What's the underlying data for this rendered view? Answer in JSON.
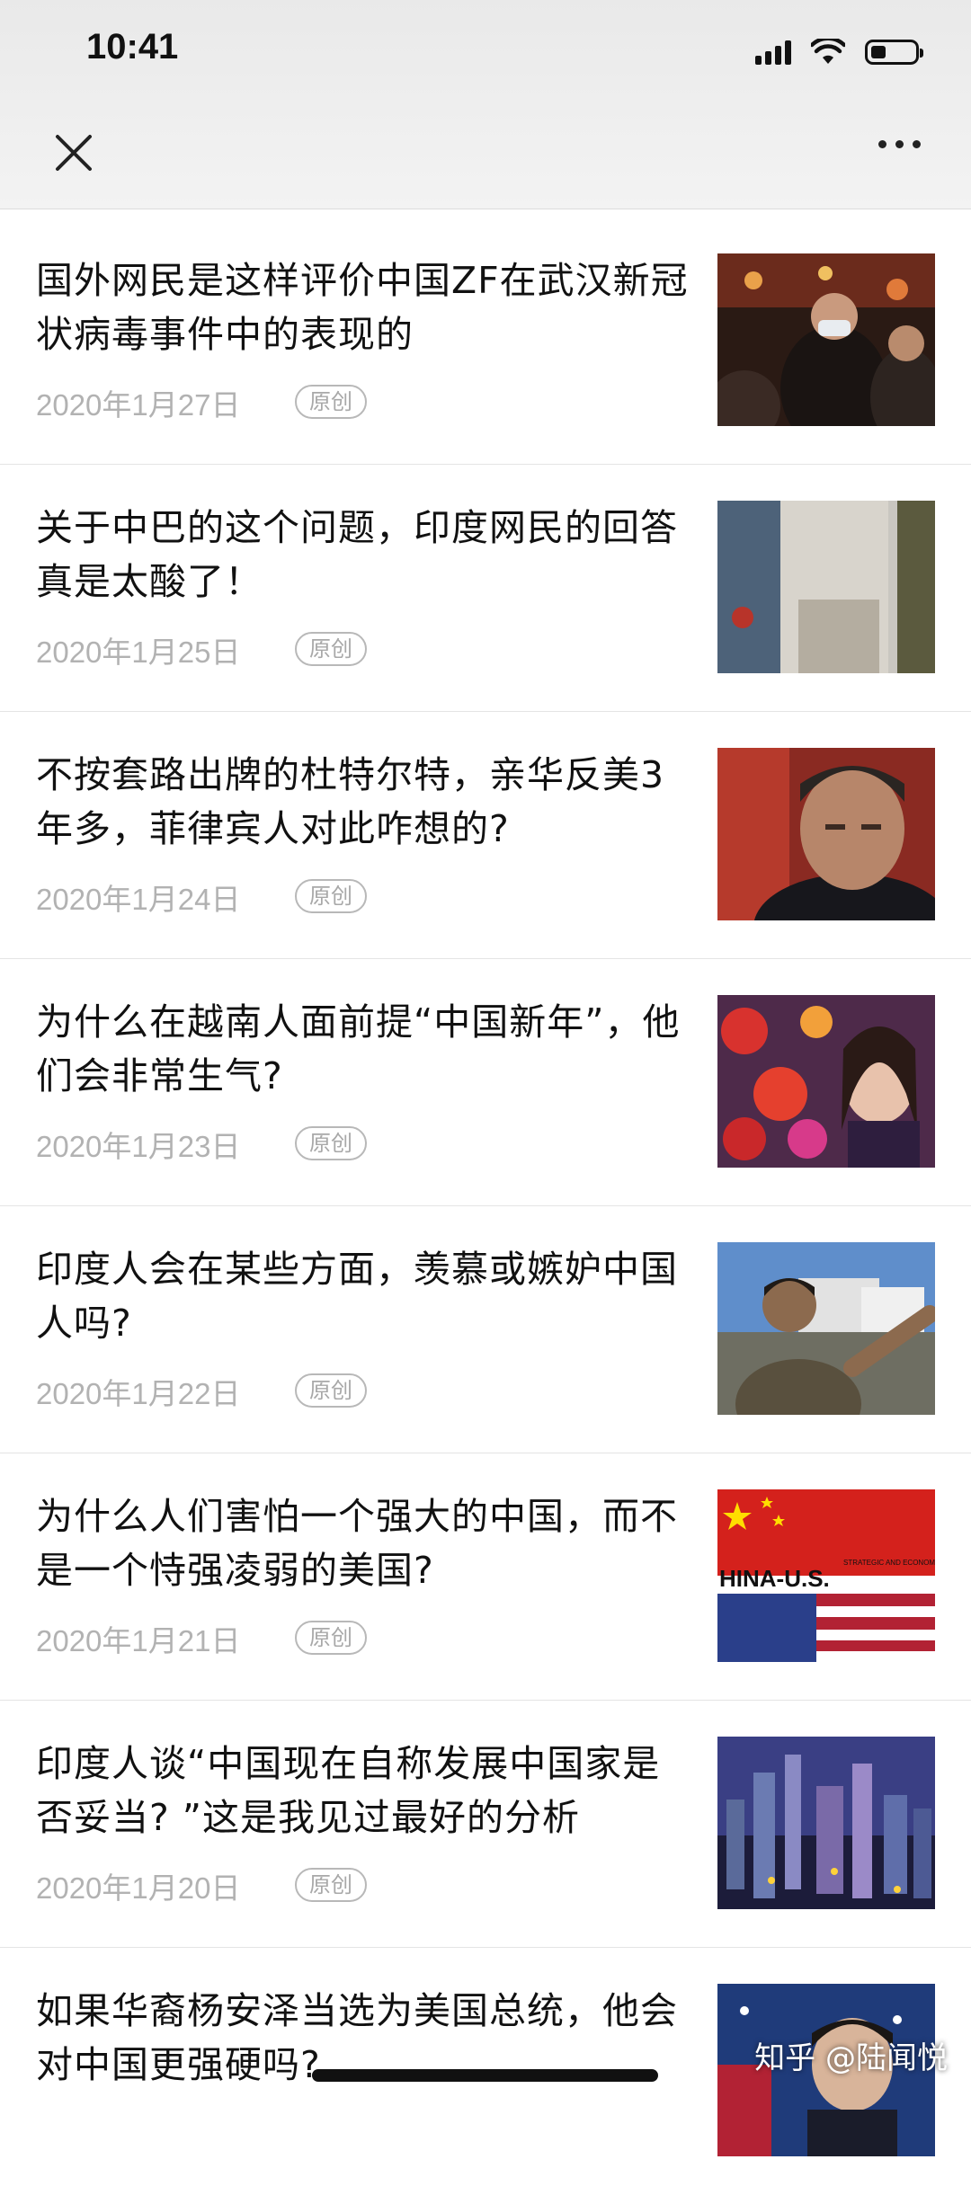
{
  "status": {
    "time": "10:41"
  },
  "nav": {
    "close_icon": "close-icon",
    "more_icon": "more-icon"
  },
  "articles": [
    {
      "title": "国外网民是这样评价中国ZF在武汉新冠状病毒事件中的表现的",
      "date": "2020年1月27日",
      "badge": "原创",
      "thumb": "crowd-masks"
    },
    {
      "title": "关于中巴的这个问题，印度网民的回答真是太酸了！",
      "date": "2020年1月25日",
      "badge": "原创",
      "thumb": "soldiers"
    },
    {
      "title": "不按套路出牌的杜特尔特，亲华反美3 年多，菲律宾人对此咋想的?",
      "date": "2020年1月24日",
      "badge": "原创",
      "thumb": "portrait-man"
    },
    {
      "title": "为什么在越南人面前提“中国新年”，他们会非常生气?",
      "date": "2020年1月23日",
      "badge": "原创",
      "thumb": "lanterns-woman"
    },
    {
      "title": "印度人会在某些方面，羡慕或嫉妒中国人吗?",
      "date": "2020年1月22日",
      "badge": "原创",
      "thumb": "street-man"
    },
    {
      "title": "为什么人们害怕一个强大的中国，而不是一个恃强凌弱的美国?",
      "date": "2020年1月21日",
      "badge": "原创",
      "thumb": "china-us-flags",
      "thumb_text": "HINA-U.S.",
      "thumb_small": "STRATEGIC AND ECONOMIC DIALOG"
    },
    {
      "title": "印度人谈“中国现在自称发展中国家是否妥当? ”这是我见过最好的分析",
      "date": "2020年1月20日",
      "badge": "原创",
      "thumb": "city-night"
    },
    {
      "title": "如果华裔杨安泽当选为美国总统，他会对中国更强硬吗?",
      "date": "",
      "badge": "",
      "thumb": "man-flag"
    }
  ],
  "watermark": "知乎 @陆闻悦",
  "colors": {
    "date_gray": "#b2b2b2",
    "divider": "#e4e4e4"
  }
}
